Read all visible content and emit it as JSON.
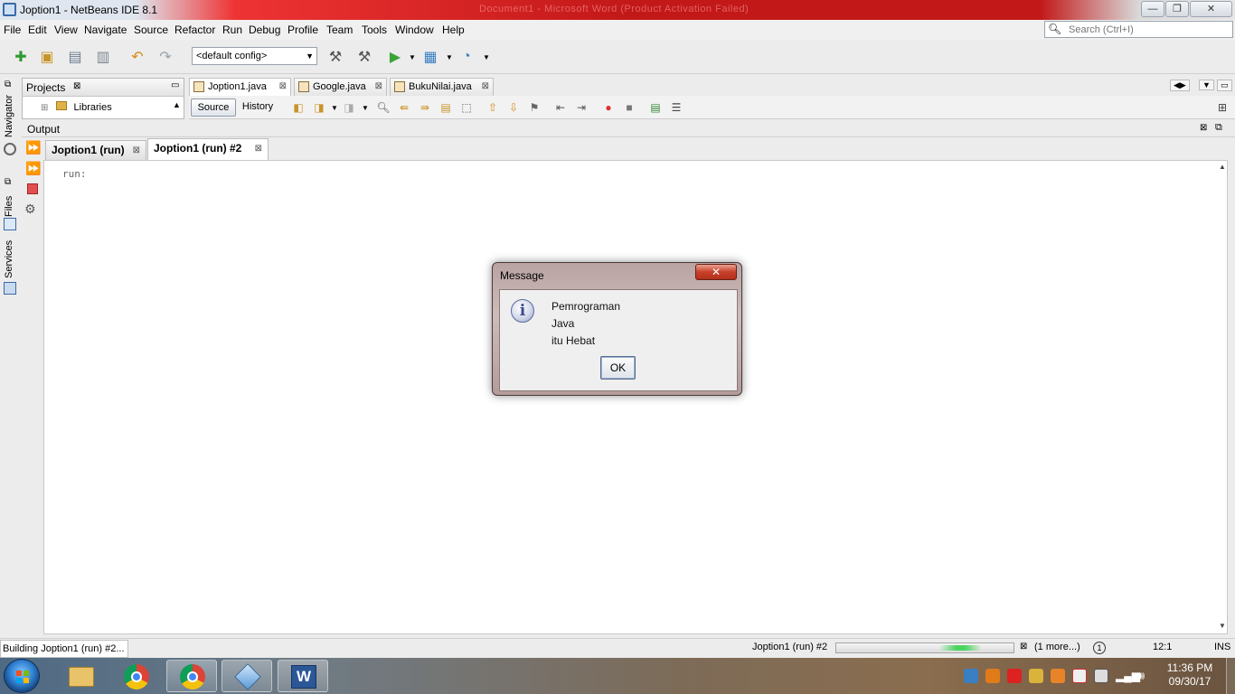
{
  "window": {
    "title": "Joption1 - NetBeans IDE 8.1",
    "background_title": "Document1 - Microsoft Word (Product Activation Failed)",
    "minimize": "—",
    "maximize": "❐",
    "close": "✕"
  },
  "menu": [
    "File",
    "Edit",
    "View",
    "Navigate",
    "Source",
    "Refactor",
    "Run",
    "Debug",
    "Profile",
    "Team",
    "Tools",
    "Window",
    "Help"
  ],
  "search": {
    "placeholder": "Search (Ctrl+I)"
  },
  "toolbar": {
    "config": "<default config>"
  },
  "sidebar": {
    "navigator": "Navigator",
    "files": "Files",
    "services": "Services"
  },
  "projects": {
    "tab": "Projects",
    "tree_item": "Libraries"
  },
  "editor": {
    "tabs": [
      "Joption1.java",
      "Google.java",
      "BukuNilai.java"
    ],
    "source": "Source",
    "history": "History"
  },
  "output": {
    "header": "Output",
    "tabs": [
      "Joption1 (run)",
      "Joption1 (run) #2"
    ],
    "text": "run:"
  },
  "dialog": {
    "title": "Message",
    "lines": [
      "Pemrograman",
      "Java",
      "itu Hebat"
    ],
    "ok": "OK",
    "icon": "i"
  },
  "status": {
    "left": "Building Joption1 (run) #2...",
    "task": "Joption1 (run) #2",
    "more": "(1 more...)",
    "position": "12:1",
    "mode": "INS",
    "progress": 0.7
  },
  "taskbar": {
    "time": "11:36 PM",
    "date": "09/30/17",
    "apps": [
      "file-explorer-icon",
      "chrome-icon",
      "chrome-icon",
      "netbeans-icon",
      "word-icon"
    ]
  },
  "colors": {
    "title_red": "#c21818",
    "dialog_frame": "#b9a3a3",
    "taskbar": "#6f7b85"
  }
}
